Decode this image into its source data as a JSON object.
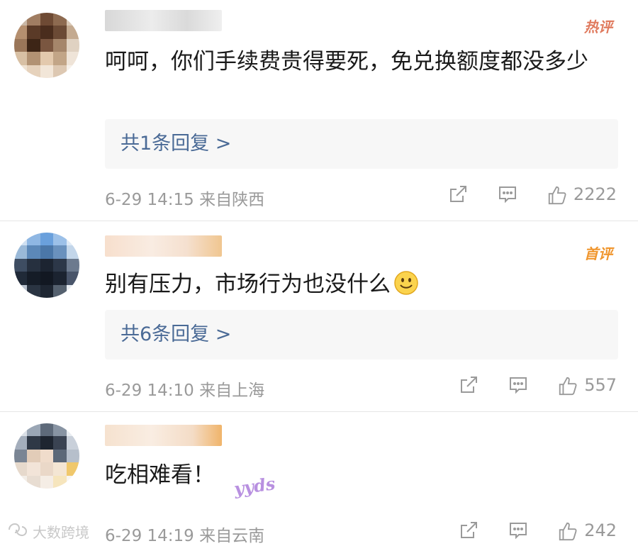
{
  "comments": [
    {
      "badge": "热评",
      "badge_color": "#e07b5f",
      "text": "呵呵，你们手续费贵得要死，免兑换额度都没多少",
      "replies": "共1条回复 >",
      "meta": "6-29 14:15 来自陕西",
      "likes": "2222"
    },
    {
      "badge": "首评",
      "badge_color": "#f0962e",
      "text": "别有压力，市场行为也没什么",
      "replies": "共6条回复 >",
      "meta": "6-29 14:10 来自上海",
      "likes": "557"
    },
    {
      "text": "吃相难看！",
      "sticker": "yyds",
      "meta": "6-29 14:19 来自云南",
      "likes": "242"
    }
  ],
  "watermark": "大数跨境",
  "icons": {
    "share": "share-icon",
    "comment": "comment-icon",
    "like": "like-icon"
  }
}
